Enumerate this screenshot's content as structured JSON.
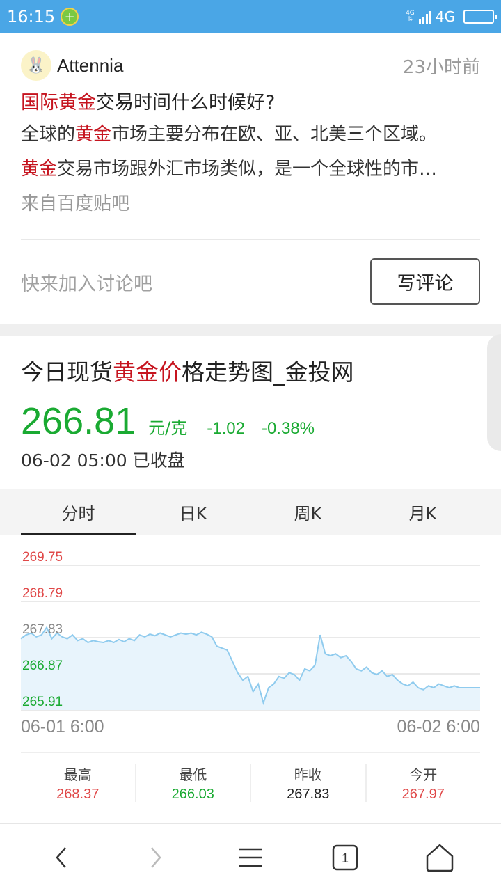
{
  "status": {
    "time": "16:15",
    "network_small": "4G",
    "network": "4G"
  },
  "post": {
    "user": "Attennia",
    "time": "23小时前",
    "title_hl": "国际黄金",
    "title_rest": "交易时间什么时候好?",
    "line1_a": "全球的",
    "line1_hl": "黄金",
    "line1_b": "市场主要分布在欧、亚、北美三个区域。",
    "line2_hl": "黄金",
    "line2_b": "交易市场跟外汇市场类似，是一个全球性的市…",
    "source": "来自百度贴吧",
    "comment_prompt": "快来加入讨论吧",
    "write_comment": "写评论"
  },
  "card": {
    "title_a": "今日现货",
    "title_hl": "黄金价",
    "title_b": "格走势图_金投网",
    "price": "266.81",
    "unit": "元/克",
    "change": "-1.02",
    "change_pct": "-0.38%",
    "date_status": "06-02 05:00 已收盘"
  },
  "tabs": [
    "分时",
    "日K",
    "周K",
    "月K"
  ],
  "axis": {
    "start": "06-01 6:00",
    "end": "06-02 6:00"
  },
  "stats": [
    {
      "label": "最高",
      "value": "268.37",
      "color": "#e04848"
    },
    {
      "label": "最低",
      "value": "266.03",
      "color": "#1aaa32"
    },
    {
      "label": "昨收",
      "value": "267.83",
      "color": "#222222"
    },
    {
      "label": "今开",
      "value": "267.97",
      "color": "#e04848"
    }
  ],
  "colors": {
    "up": "#e04848",
    "down": "#1aaa32",
    "line": "#8fcbee",
    "fill": "#e8f4fc",
    "highlight": "#c6141f"
  },
  "chart_data": {
    "type": "line",
    "y_ticks": [
      {
        "label": "269.75",
        "color": "#e04848"
      },
      {
        "label": "268.79",
        "color": "#e04848"
      },
      {
        "label": "267.83",
        "color": "#888888"
      },
      {
        "label": "266.87",
        "color": "#1aaa32"
      },
      {
        "label": "265.91",
        "color": "#1aaa32"
      }
    ],
    "ylim": [
      265.91,
      269.75
    ],
    "x_range": [
      "06-01 6:00",
      "06-02 6:00"
    ],
    "values": [
      267.8,
      267.9,
      267.95,
      267.85,
      267.9,
      268.1,
      267.8,
      267.95,
      267.85,
      267.8,
      267.9,
      267.75,
      267.8,
      267.7,
      267.75,
      267.72,
      267.7,
      267.75,
      267.7,
      267.78,
      267.72,
      267.8,
      267.75,
      267.9,
      267.85,
      267.92,
      267.88,
      267.95,
      267.9,
      267.85,
      267.9,
      267.95,
      267.92,
      267.95,
      267.9,
      267.97,
      267.92,
      267.85,
      267.6,
      267.55,
      267.5,
      267.2,
      266.9,
      266.7,
      266.8,
      266.4,
      266.6,
      266.1,
      266.5,
      266.6,
      266.8,
      266.75,
      266.9,
      266.85,
      266.7,
      267.0,
      266.95,
      267.1,
      267.9,
      267.4,
      267.35,
      267.4,
      267.3,
      267.35,
      267.2,
      267.0,
      266.95,
      267.05,
      266.9,
      266.85,
      266.95,
      266.8,
      266.85,
      266.7,
      266.6,
      266.55,
      266.65,
      266.5,
      266.45,
      266.55,
      266.5,
      266.6,
      266.55,
      266.5,
      266.55,
      266.5,
      266.5,
      266.5,
      266.5,
      266.5
    ]
  }
}
